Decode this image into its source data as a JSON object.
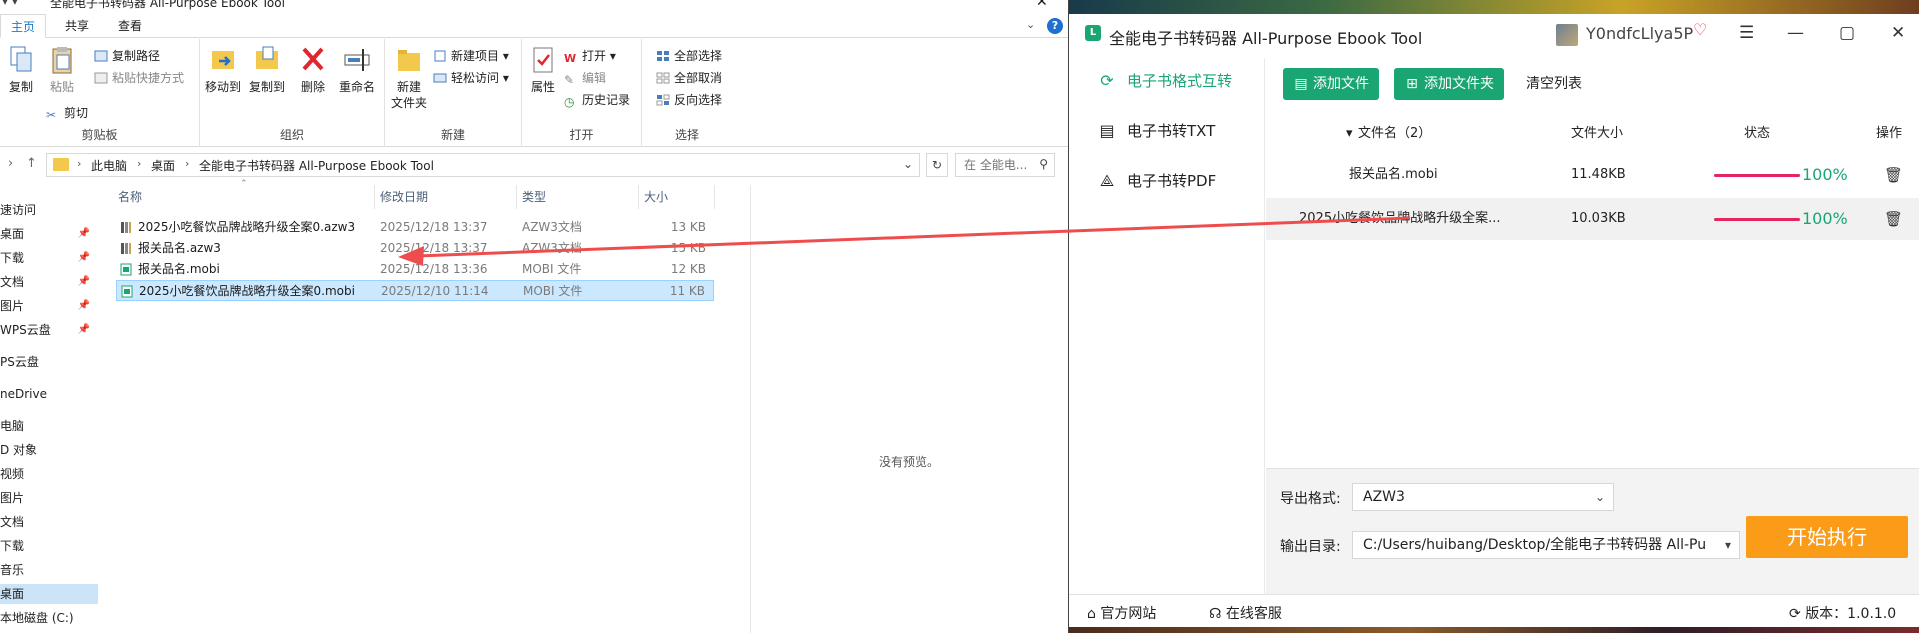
{
  "explorer": {
    "title": "全能电子书转码器 All-Purpose Ebook Tool",
    "quick_access_glyph": "▾ ▾",
    "tabs": [
      "主页",
      "共享",
      "查看"
    ],
    "ribbon": {
      "clipboard": {
        "group_label": "剪贴板",
        "copy": "复制",
        "paste": "粘贴",
        "copy_path": "复制路径",
        "paste_shortcut": "粘贴快捷方式",
        "cut": "剪切"
      },
      "organize": {
        "group_label": "组织",
        "move_to": "移动到",
        "copy_to": "复制到",
        "delete": "删除",
        "rename": "重命名"
      },
      "new": {
        "group_label": "新建",
        "new_folder_l1": "新建",
        "new_folder_l2": "文件夹",
        "new_item": "新建项目",
        "easy_access": "轻松访问"
      },
      "open": {
        "group_label": "打开",
        "properties": "属性",
        "open": "打开",
        "edit": "编辑",
        "history": "历史记录"
      },
      "select": {
        "group_label": "选择",
        "select_all": "全部选择",
        "select_none": "全部取消",
        "invert": "反向选择"
      }
    },
    "breadcrumb": [
      "此电脑",
      "桌面",
      "全能电子书转码器 All-Purpose Ebook Tool"
    ],
    "search_placeholder": "在 全能电...",
    "nav_items": [
      {
        "label": "速访问",
        "pinned": false,
        "selected": false
      },
      {
        "label": "桌面",
        "pinned": true,
        "selected": false
      },
      {
        "label": "下载",
        "pinned": true,
        "selected": false
      },
      {
        "label": "文档",
        "pinned": true,
        "selected": false
      },
      {
        "label": "图片",
        "pinned": true,
        "selected": false
      },
      {
        "label": "WPS云盘",
        "pinned": true,
        "selected": false
      },
      {
        "label": "PS云盘",
        "pinned": false,
        "selected": false
      },
      {
        "label": "neDrive",
        "pinned": false,
        "selected": false
      },
      {
        "label": "电脑",
        "pinned": false,
        "selected": false
      },
      {
        "label": "D 对象",
        "pinned": false,
        "selected": false
      },
      {
        "label": "视频",
        "pinned": false,
        "selected": false
      },
      {
        "label": "图片",
        "pinned": false,
        "selected": false
      },
      {
        "label": "文档",
        "pinned": false,
        "selected": false
      },
      {
        "label": "下载",
        "pinned": false,
        "selected": false
      },
      {
        "label": "音乐",
        "pinned": false,
        "selected": false
      },
      {
        "label": "桌面",
        "pinned": false,
        "selected": true
      },
      {
        "label": "本地磁盘 (C:)",
        "pinned": false,
        "selected": false
      }
    ],
    "columns": {
      "name": "名称",
      "modified": "修改日期",
      "type": "类型",
      "size": "大小"
    },
    "files": [
      {
        "name": "2025小吃餐饮品牌战略升级全案0.azw3",
        "modified": "2025/12/18 13:37",
        "type": "AZW3文档",
        "size": "13 KB",
        "icon": "azw3-file-icon",
        "selected": false
      },
      {
        "name": "报关品名.azw3",
        "modified": "2025/12/18 13:37",
        "type": "AZW3文档",
        "size": "15 KB",
        "icon": "azw3-file-icon",
        "selected": false
      },
      {
        "name": "报关品名.mobi",
        "modified": "2025/12/18 13:36",
        "type": "MOBI 文件",
        "size": "12 KB",
        "icon": "mobi-file-icon",
        "selected": false
      },
      {
        "name": "2025小吃餐饮品牌战略升级全案0.mobi",
        "modified": "2025/12/10 11:14",
        "type": "MOBI 文件",
        "size": "11 KB",
        "icon": "mobi-file-icon",
        "selected": true
      }
    ],
    "preview_message": "没有预览。"
  },
  "app": {
    "title": "全能电子书转码器 All-Purpose Ebook Tool",
    "username": "Y0ndfcLlya5P",
    "sidebar": [
      {
        "label": "电子书格式互转",
        "icon": "refresh-icon",
        "active": true
      },
      {
        "label": "电子书转TXT",
        "icon": "document-icon",
        "active": false
      },
      {
        "label": "电子书转PDF",
        "icon": "pdf-icon",
        "active": false
      }
    ],
    "toolbar": {
      "add_file": "添加文件",
      "add_folder": "添加文件夹",
      "clear_list": "清空列表"
    },
    "table_headers": {
      "filename": "文件名（2）",
      "size": "文件大小",
      "status": "状态",
      "action": "操作"
    },
    "rows": [
      {
        "filename": "报关品名.mobi",
        "size": "11.48KB",
        "progress": 100,
        "progress_label": "100%"
      },
      {
        "filename": "2025小吃餐饮品牌战略升级全案...",
        "size": "10.03KB",
        "progress": 100,
        "progress_label": "100%"
      }
    ],
    "export_format_label": "导出格式:",
    "export_format_value": "AZW3",
    "output_dir_label": "输出目录:",
    "output_dir_value": "C:/Users/huibang/Desktop/全能电子书转码器 All-Pu",
    "start_button": "开始执行",
    "footer": {
      "website": "官方网站",
      "support": "在线客服",
      "version": "版本：1.0.1.0"
    },
    "accent_green": "#19a672",
    "accent_orange": "#fa9c18",
    "progress_color": "#e5255f"
  },
  "annotation_arrow_color": "#ef4d4d"
}
